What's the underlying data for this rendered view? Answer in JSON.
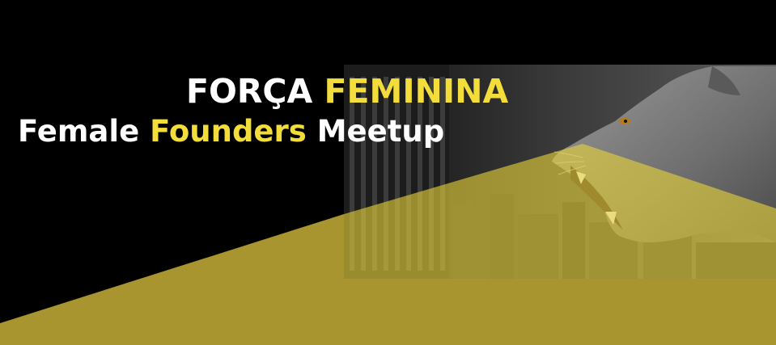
{
  "headline": {
    "line1": {
      "part1": "FORÇA",
      "part2": "FEMININA"
    },
    "line2": {
      "part1": "Female",
      "part2": "Founders",
      "part3": "Meetup"
    }
  },
  "colors": {
    "background": "#000000",
    "accent_yellow": "#f2dd3a",
    "olive_band": "#a8952f",
    "text_white": "#ffffff",
    "city_gray": "#2e2e2e",
    "lioness_gray": "#8a8a8a"
  },
  "illustration": {
    "subject": "lioness-roaring",
    "backdrop": "city-skyline"
  }
}
